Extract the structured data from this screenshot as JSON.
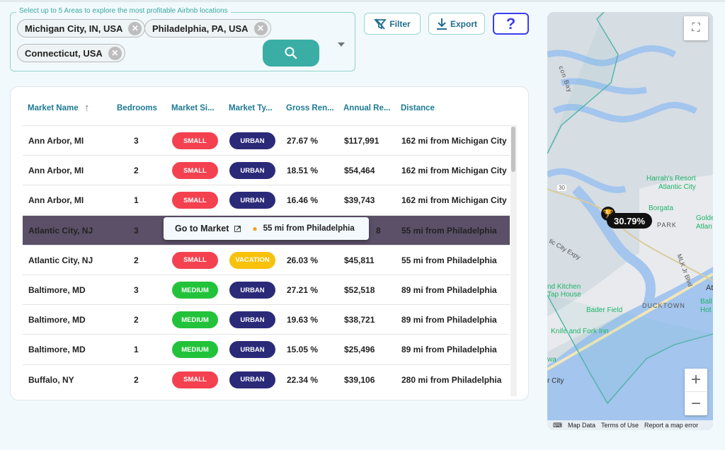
{
  "search": {
    "legend": "Select up to 5 Areas to explore the most profitable Airbnb locations",
    "chips": [
      "Michigan City, IN, USA",
      "Philadelphia, PA, USA",
      "Connecticut, USA"
    ]
  },
  "toolbar": {
    "filter": "Filter",
    "export": "Export",
    "help": "?"
  },
  "table": {
    "columns": [
      "Market Name",
      "Bedrooms",
      "Market Si...",
      "Market Ty...",
      "Gross Ren...",
      "Annual Re...",
      "Distance"
    ],
    "sort_column": "Market Name",
    "sort_direction": "ascending",
    "rows": [
      {
        "name": "Ann Arbor, MI",
        "bedrooms": "3",
        "size": "SMALL",
        "type": "URBAN",
        "gross": "27.67 %",
        "annual": "$117,991",
        "distance": "162 mi from Michigan City"
      },
      {
        "name": "Ann Arbor, MI",
        "bedrooms": "2",
        "size": "SMALL",
        "type": "URBAN",
        "gross": "18.51 %",
        "annual": "$54,464",
        "distance": "162 mi from Michigan City"
      },
      {
        "name": "Ann Arbor, MI",
        "bedrooms": "1",
        "size": "SMALL",
        "type": "URBAN",
        "gross": "16.46 %",
        "annual": "$39,743",
        "distance": "162 mi from Michigan City"
      },
      {
        "name": "Atlantic City, NJ",
        "bedrooms": "3",
        "size": "",
        "type": "",
        "gross": "",
        "annual": "8",
        "distance": "55 mi from Philadelphia"
      },
      {
        "name": "Atlantic City, NJ",
        "bedrooms": "2",
        "size": "SMALL",
        "type": "VACATION",
        "gross": "26.03 %",
        "annual": "$45,811",
        "distance": "55 mi from Philadelphia"
      },
      {
        "name": "Baltimore, MD",
        "bedrooms": "3",
        "size": "MEDIUM",
        "type": "URBAN",
        "gross": "27.21 %",
        "annual": "$52,518",
        "distance": "89 mi from Philadelphia"
      },
      {
        "name": "Baltimore, MD",
        "bedrooms": "2",
        "size": "MEDIUM",
        "type": "URBAN",
        "gross": "19.63 %",
        "annual": "$38,721",
        "distance": "89 mi from Philadelphia"
      },
      {
        "name": "Baltimore, MD",
        "bedrooms": "1",
        "size": "MEDIUM",
        "type": "URBAN",
        "gross": "15.05 %",
        "annual": "$25,496",
        "distance": "89 mi from Philadelphia"
      },
      {
        "name": "Buffalo, NY",
        "bedrooms": "2",
        "size": "SMALL",
        "type": "URBAN",
        "gross": "22.34 %",
        "annual": "$39,106",
        "distance": "280 mi from Philadelphia"
      }
    ],
    "selected_row": 3
  },
  "tooltip": {
    "go": "Go to Market",
    "distance": "55 mi from Philadelphia"
  },
  "colors": {
    "SMALL": "#f44150",
    "MEDIUM": "#22c33a",
    "URBAN": "#2b2a78",
    "VACATION": "#f8c10a",
    "accent": "#3aaea5",
    "highlight": "#5b5068"
  },
  "map": {
    "marker": "30.79%",
    "labels": {
      "harrahs": "Harrah's Resort",
      "harrahs2": "Atlantic City",
      "borgata": "Borgata",
      "golden": "Golde",
      "golden2": "Atlan",
      "park": "PARK",
      "bader": "Bader Field",
      "ducktown": "DUCKTOWN",
      "knife": "Knife and Fork Inn",
      "kitchen": "nd Kitchen",
      "taphouse": "Tap House",
      "atl": "Atl",
      "ball": "Ball",
      "hot": "Hot",
      "city": "r City",
      "wa": "wa",
      "expy": "tic City Expy",
      "mlk": "MLK Jr Blvd",
      "bay": "con Bay",
      "r30": "30"
    },
    "zoom_in": "+",
    "zoom_out": "−",
    "footer": [
      "Map Data",
      "Terms of Use",
      "Report a map error"
    ]
  }
}
